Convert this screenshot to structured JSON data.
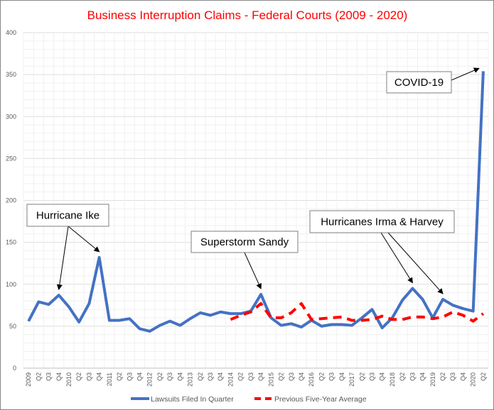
{
  "chart_data": {
    "type": "line",
    "title": "Business Interruption Claims - Federal Courts (2009 - 2020)",
    "ylim": [
      0,
      400
    ],
    "yticks": [
      0,
      50,
      100,
      150,
      200,
      250,
      300,
      350,
      400
    ],
    "grid": true,
    "legend_placement": "bottom",
    "categories": [
      "2009",
      "Q2",
      "Q3",
      "Q4",
      "2010",
      "Q2",
      "Q3",
      "Q4",
      "2011",
      "Q2",
      "Q3",
      "Q4",
      "2012",
      "Q2",
      "Q3",
      "Q4",
      "2013",
      "Q2",
      "Q3",
      "Q4",
      "2014",
      "Q2",
      "Q3",
      "Q4",
      "2015",
      "Q2",
      "Q3",
      "Q4",
      "2016",
      "Q2",
      "Q3",
      "Q4",
      "2017",
      "Q2",
      "Q3",
      "Q4",
      "2018",
      "Q2",
      "Q3",
      "Q4",
      "2019",
      "Q2",
      "Q3",
      "Q4",
      "2020",
      "Q2"
    ],
    "series": [
      {
        "name": "Lawsuits Filed In Quarter",
        "color": "#4472C4",
        "style": "solid",
        "start_index": 0,
        "values": [
          56,
          79,
          76,
          87,
          73,
          55,
          77,
          132,
          57,
          57,
          59,
          47,
          44,
          51,
          56,
          51,
          59,
          66,
          63,
          67,
          65,
          65,
          68,
          88,
          60,
          51,
          53,
          49,
          57,
          50,
          52,
          52,
          51,
          60,
          70,
          48,
          60,
          81,
          95,
          82,
          60,
          82,
          75,
          71,
          68,
          354
        ]
      },
      {
        "name": "Previous Five-Year Average",
        "color": "#FF0000",
        "style": "dashed",
        "start_index": 20,
        "values": [
          58,
          63,
          67,
          77,
          60,
          60,
          66,
          77,
          58,
          59,
          60,
          61,
          57,
          57,
          58,
          62,
          58,
          58,
          61,
          61,
          59,
          61,
          67,
          63,
          56,
          65
        ]
      }
    ],
    "annotations": [
      {
        "text": "Hurricane Ike",
        "targets": [
          3,
          7
        ]
      },
      {
        "text": "Superstorm  Sandy",
        "targets": [
          23
        ]
      },
      {
        "text": "Hurricanes Irma & Harvey",
        "targets": [
          38,
          41
        ]
      },
      {
        "text": "COVID-19",
        "targets": [
          45
        ]
      }
    ]
  }
}
